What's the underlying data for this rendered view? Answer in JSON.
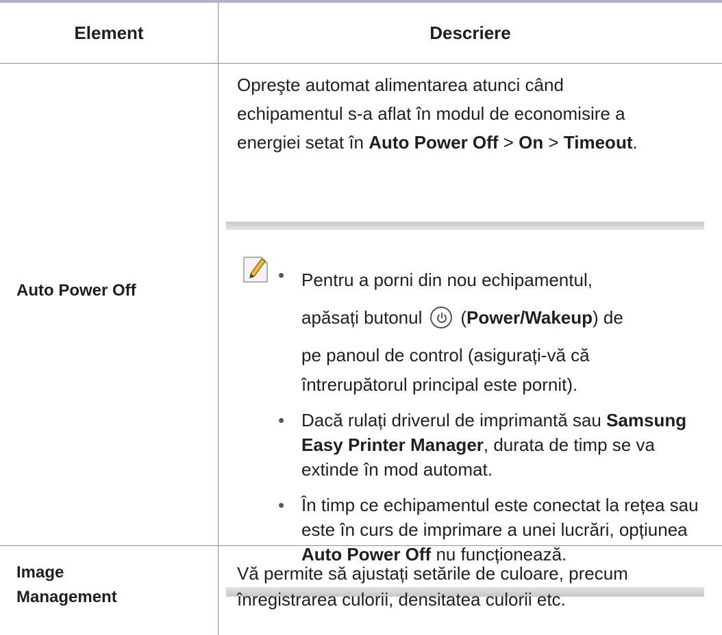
{
  "table": {
    "header": {
      "element": "Element",
      "description": "Descriere"
    },
    "rows": [
      {
        "element": "Auto Power Off",
        "description": {
          "line1": "Opreşte automat alimentarea atunci când",
          "line2": "echipamentul s-a aflat în modul de economisire a",
          "line3_pre": "energiei setat în ",
          "path_1": "Auto Power Off",
          "sep_1": " > ",
          "path_2": "On",
          "sep_2": " > ",
          "path_3": "Timeout",
          "line3_end": "."
        },
        "note": {
          "icon": "note-pencil-icon",
          "items": [
            {
              "line1": "Pentru a porni din nou echipamentul,",
              "line2_pre": "apăsați butonul",
              "button_icon": "power-icon",
              "line2_paren_open": "(",
              "button_name": "Power/Wakeup",
              "line2_paren_close": ") de",
              "line3": "pe panoul de control (asigurați-vă că",
              "line4": "întrerupătorul principal este pornit)."
            },
            {
              "text_pre": "Dacă rulați driverul de imprimantă sau ",
              "bold": "Samsung Easy Printer Manager",
              "text_post": ", durata de timp se va extinde în mod automat."
            },
            {
              "text_pre": "În timp ce echipamentul este conectat la rețea sau este în curs de imprimare a unei lucrări, opțiunea ",
              "bold": "Auto Power Off",
              "text_post": " nu funcționează."
            }
          ]
        }
      },
      {
        "element_line1": "Image",
        "element_line2": "Management",
        "description": "Vă permite să ajustați setările de culoare, precum înregistrarea culorii, densitatea culorii etc."
      }
    ]
  },
  "colors": {
    "top_rule": "#b3b1cc",
    "grid_line": "#8b8b8b",
    "note_bar": "#d4d4d4",
    "text": "#1f1f1f",
    "icon_accent": "#f2b632"
  }
}
